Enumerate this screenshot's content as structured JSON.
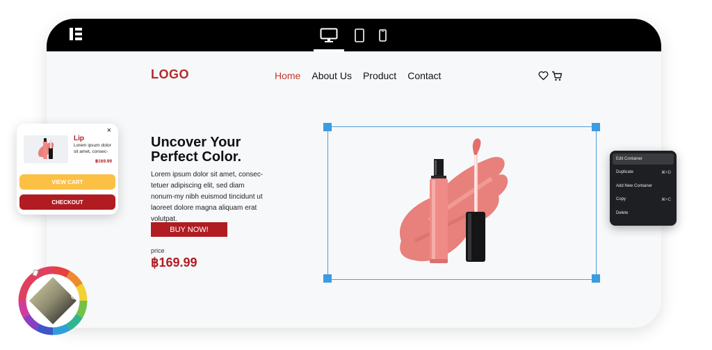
{
  "editor": {
    "device_modes": [
      "desktop",
      "tablet",
      "mobile"
    ],
    "active_device": "desktop"
  },
  "site": {
    "logo": "LOGO",
    "nav": [
      "Home",
      "About Us",
      "Product",
      "Contact"
    ],
    "nav_active": "Home"
  },
  "hero": {
    "title": "Uncover Your Perfect Color.",
    "description": "Lorem ipsum dolor sit amet, consec-tetuer adipiscing elit, sed diam nonum-my nibh euismod tincidunt ut laoreet dolore magna aliquam erat volutpat.",
    "buy_label": "BUY NOW!",
    "price_label": "price",
    "price_value": "฿169.99"
  },
  "cart_popup": {
    "close": "×",
    "product_name": "Lip",
    "product_desc": "Lorem ipsum dolor sit amet, consec-",
    "product_price": "฿169.99",
    "view_cart_label": "VIEW CART",
    "checkout_label": "CHECKOUT"
  },
  "context_menu": {
    "items": [
      {
        "label": "Edit Container",
        "shortcut": ""
      },
      {
        "label": "Duplicate",
        "shortcut": "⌘+D"
      },
      {
        "label": "Add New Container",
        "shortcut": ""
      },
      {
        "label": "Copy",
        "shortcut": "⌘+C"
      },
      {
        "label": "Delete",
        "shortcut": ""
      }
    ]
  },
  "colors": {
    "brand_red": "#b01c22",
    "accent_yellow": "#fcc045",
    "selection_blue": "#3d9be0"
  }
}
